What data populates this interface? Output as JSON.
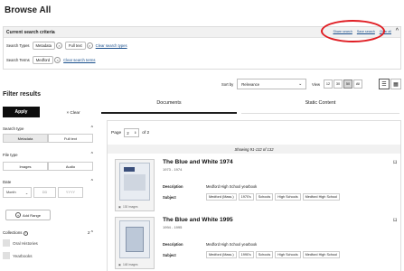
{
  "page_title": "Browse All",
  "criteria": {
    "title": "Current search criteria",
    "links": [
      "Share search",
      "Save search",
      "Clear all"
    ],
    "search_types_label": "Search Types",
    "search_types": [
      "Metadata",
      "Full text"
    ],
    "clear_types": "Clear search types",
    "search_terms_label": "Search Terms",
    "search_terms": [
      "Medford"
    ],
    "clear_terms": "Clear search terms"
  },
  "sortbar": {
    "sort_label": "Sort by",
    "sort_value": "Relevance",
    "view_label": "View",
    "view_options": [
      "12",
      "30",
      "50",
      "All"
    ],
    "view_selected": "50"
  },
  "filters": {
    "title": "Filter results",
    "apply": "Apply",
    "clear": "× Clear",
    "search_type": {
      "label": "Search type",
      "options": [
        "Metadata",
        "Full text"
      ]
    },
    "file_type": {
      "label": "File type",
      "options": [
        "Images",
        "Audio"
      ]
    },
    "date": {
      "label": "Date",
      "month": "Month",
      "dd": "DD",
      "yyyy": "YYYY",
      "add_range": "Add Range"
    },
    "collections": {
      "label": "Collections",
      "count": "2",
      "items": [
        "Oral Histories",
        "Yearbooks"
      ]
    }
  },
  "tabs": [
    "Documents",
    "Static Content"
  ],
  "results": {
    "page_label": "Page",
    "page_value": "2",
    "of_label": "of 2",
    "showing": "Showing 91-132 of 132",
    "items": [
      {
        "title": "The Blue and White 1974",
        "years": "1973 - 1974",
        "description_label": "Description",
        "description": "Medford High School yearbook",
        "subject_label": "Subject",
        "subjects": [
          "Medford (Mass.)",
          "1970's",
          "Schools",
          "High Schools",
          "Medford High School"
        ],
        "images": "130 images"
      },
      {
        "title": "The Blue and White 1995",
        "years": "1994 - 1995",
        "description_label": "Description",
        "description": "Medford High School yearbook",
        "subject_label": "Subject",
        "subjects": [
          "Medford (Mass.)",
          "1990's",
          "Schools",
          "High Schools",
          "Medford High School"
        ],
        "images": "148 images"
      }
    ]
  }
}
